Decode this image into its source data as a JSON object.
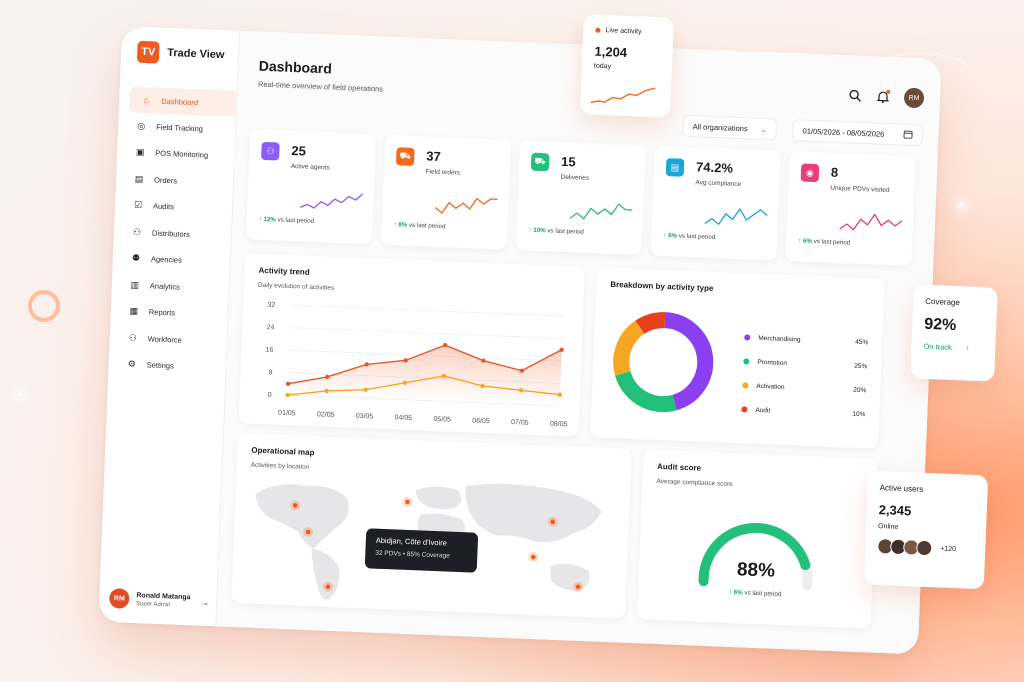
{
  "brand": {
    "logo": "TV",
    "name": "Trade View"
  },
  "sidebar": {
    "items": [
      {
        "label": "Dashboard",
        "icon": "home-icon",
        "active": true
      },
      {
        "label": "Field Tracking",
        "icon": "pin-icon"
      },
      {
        "label": "POS Monitoring",
        "icon": "store-icon"
      },
      {
        "label": "Orders",
        "icon": "clipboard-icon"
      },
      {
        "label": "Audits",
        "icon": "checklist-icon"
      },
      {
        "label": "Distributors",
        "icon": "people-icon"
      },
      {
        "label": "Agencies",
        "icon": "group-icon"
      },
      {
        "label": "Analytics",
        "icon": "chart-icon"
      },
      {
        "label": "Reports",
        "icon": "document-icon"
      },
      {
        "label": "Workforce",
        "icon": "team-icon"
      },
      {
        "label": "Settings",
        "icon": "gear-icon"
      }
    ],
    "user": {
      "initials": "RM",
      "name": "Ronald Matanga",
      "role": "Super Admin"
    }
  },
  "header": {
    "title": "Dashboard",
    "subtitle": "Real-time overview of field operations",
    "avatar": "RM",
    "org_filter": "All organizations",
    "date_range": "01/05/2026 - 08/05/2026"
  },
  "kpis": [
    {
      "value": "25",
      "label": "Active agents",
      "delta": "12%",
      "delta_text": "vs last period",
      "color": "#8b5cf6",
      "icon": "people-icon",
      "spark": [
        3,
        4,
        3,
        5,
        4,
        6,
        5,
        7,
        6,
        8
      ]
    },
    {
      "value": "37",
      "label": "Field orders",
      "delta": "8%",
      "delta_text": "vs last period",
      "color": "#f26a1b",
      "icon": "cart-icon",
      "spark": [
        3,
        2,
        4,
        3,
        4,
        3,
        5,
        4,
        5,
        5
      ]
    },
    {
      "value": "15",
      "label": "Deliveries",
      "delta": "10%",
      "delta_text": "vs last period",
      "color": "#22c07a",
      "icon": "truck-icon",
      "spark": [
        4,
        5,
        4,
        6,
        5,
        6,
        5,
        7,
        6,
        6
      ]
    },
    {
      "value": "74.2%",
      "label": "Avg compliance",
      "delta": "6%",
      "delta_text": "vs last period",
      "color": "#1aa6d8",
      "icon": "clipboard-icon",
      "spark": [
        3,
        4,
        3,
        5,
        4,
        6,
        4,
        5,
        6,
        5
      ]
    },
    {
      "value": "8",
      "label": "Unique PDVs visited",
      "delta": "6%",
      "delta_text": "vs last period",
      "color": "#ec3a7a",
      "icon": "pin-icon",
      "spark": [
        4,
        5,
        4,
        6,
        5,
        7,
        5,
        6,
        5,
        6
      ]
    }
  ],
  "trend": {
    "title": "Activity trend",
    "subtitle": "Daily evolution of activities"
  },
  "chart_data": [
    {
      "type": "area",
      "title": "Activity trend",
      "x": [
        "01/05",
        "02/05",
        "03/05",
        "04/05",
        "05/05",
        "06/05",
        "07/05",
        "08/05"
      ],
      "yticks": [
        0,
        8,
        16,
        24,
        32
      ],
      "ylim": [
        0,
        32
      ],
      "grid": true,
      "series": [
        {
          "values": [
            4,
            7,
            12,
            14,
            20,
            15,
            12,
            20
          ],
          "color": "#e8582a"
        },
        {
          "values": [
            0,
            2,
            3,
            6,
            9,
            6,
            5,
            4
          ],
          "color": "#f5a623"
        }
      ]
    },
    {
      "type": "pie",
      "title": "Breakdown by activity type",
      "labels": [
        "Merchandising",
        "Promotion",
        "Activation",
        "Audit"
      ],
      "values": [
        45,
        25,
        20,
        10
      ],
      "value_labels": [
        "45%",
        "25%",
        "20%",
        "10%"
      ],
      "colors": [
        "#8b3ff0",
        "#22c07a",
        "#f5a623",
        "#e8401d"
      ]
    }
  ],
  "breakdown": {
    "title": "Breakdown by activity type"
  },
  "map": {
    "title": "Operational map",
    "subtitle": "Activities by location",
    "tooltip_title": "Abidjan, Côte d'Ivoire",
    "tooltip_detail": "32 PDVs • 85% Coverage"
  },
  "audit": {
    "title": "Audit score",
    "subtitle": "Average compliance score",
    "value": "88%",
    "fraction": 0.88,
    "delta": "6%",
    "delta_text": "vs last period"
  },
  "live": {
    "label": "Live activity",
    "value": "1,204",
    "sub": "today"
  },
  "coverage": {
    "label": "Coverage",
    "value": "92%",
    "status": "On track"
  },
  "active_users": {
    "label": "Active users",
    "value": "2,345",
    "sub": "Online",
    "extra": "+120"
  }
}
